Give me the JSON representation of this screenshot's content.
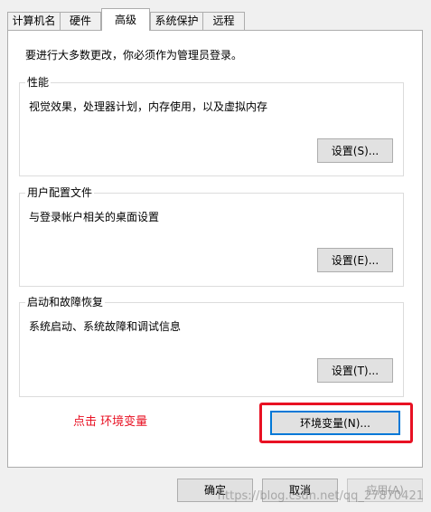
{
  "tabs": [
    {
      "label": "计算机名"
    },
    {
      "label": "硬件"
    },
    {
      "label": "高级"
    },
    {
      "label": "系统保护"
    },
    {
      "label": "远程"
    }
  ],
  "admin_note": "要进行大多数更改，你必须作为管理员登录。",
  "performance": {
    "title": "性能",
    "description": "视觉效果，处理器计划，内存使用，以及虚拟内存",
    "button": "设置(S)..."
  },
  "user_profiles": {
    "title": "用户配置文件",
    "description": "与登录帐户相关的桌面设置",
    "button": "设置(E)..."
  },
  "startup_recovery": {
    "title": "启动和故障恢复",
    "description": "系统启动、系统故障和调试信息",
    "button": "设置(T)..."
  },
  "env_button": "环境变量(N)...",
  "annotation": "点击  环境变量",
  "footer": {
    "ok": "确定",
    "cancel": "取消",
    "apply": "应用(A)"
  },
  "watermark": "https://blog.csdn.net/qq_27870421",
  "colors": {
    "highlight": "#e81123",
    "focus": "#0078d7"
  }
}
